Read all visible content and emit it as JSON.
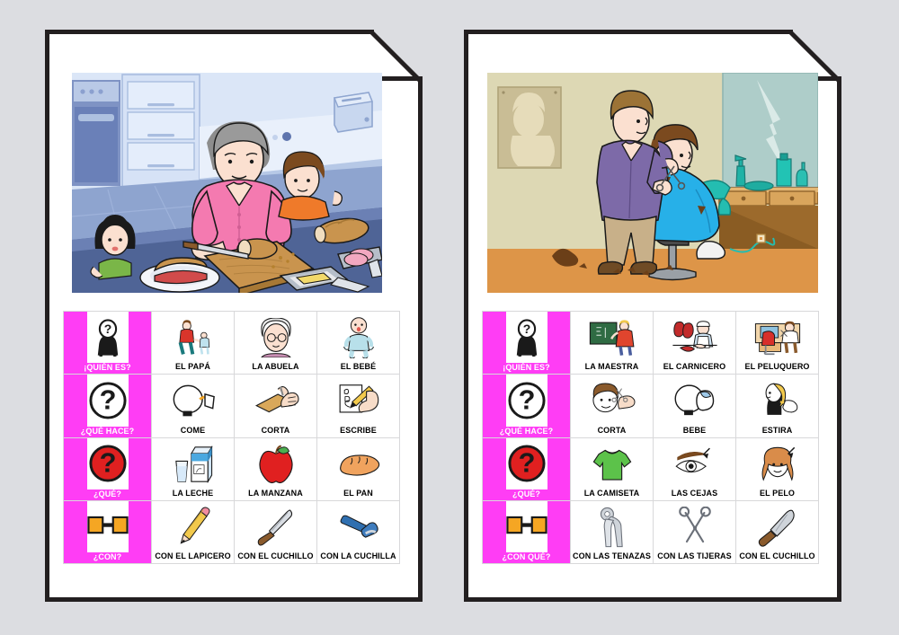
{
  "background_color": "#dcdde1",
  "pages": [
    {
      "id": "page-left",
      "scene": {
        "name": "kitchen-scene",
        "description": "Father cutting bread on a wooden cutting board in a kitchen while two children watch",
        "background_color": "#5b6fa6"
      },
      "table": {
        "rows": [
          {
            "question": {
              "label": "¡QUIÉN ES?",
              "icon": "person-question-icon"
            },
            "cells": [
              {
                "label": "EL PAPÁ",
                "icon": "father-and-child-icon"
              },
              {
                "label": "LA ABUELA",
                "icon": "grandmother-icon"
              },
              {
                "label": "EL BEBÉ",
                "icon": "baby-icon"
              }
            ]
          },
          {
            "question": {
              "label": "¿QUÉ HACE?",
              "icon": "circle-question-icon"
            },
            "cells": [
              {
                "label": "COME",
                "icon": "eating-mouth-icon"
              },
              {
                "label": "CORTA",
                "icon": "hands-cutting-bread-icon"
              },
              {
                "label": "ESCRIBE",
                "icon": "hand-writing-icon"
              }
            ]
          },
          {
            "question": {
              "label": "¿QUÉ?",
              "icon": "red-circle-question-icon"
            },
            "cells": [
              {
                "label": "LA LECHE",
                "icon": "milk-carton-icon"
              },
              {
                "label": "LA MANZANA",
                "icon": "apple-icon"
              },
              {
                "label": "EL PAN",
                "icon": "bread-loaf-icon"
              }
            ]
          },
          {
            "question": {
              "label": "¿CON?",
              "icon": "two-squares-link-icon"
            },
            "cells": [
              {
                "label": "CON EL LAPICERO",
                "icon": "pencil-icon"
              },
              {
                "label": "CON EL CUCHILLO",
                "icon": "knife-icon"
              },
              {
                "label": "CON LA CUCHILLA",
                "icon": "razor-blade-icon"
              }
            ]
          }
        ]
      }
    },
    {
      "id": "page-right",
      "scene": {
        "name": "barber-shop-scene",
        "description": "Barber cutting a boy's hair in a salon with mirror, hair dryer and dressing table",
        "background_color": "#ddd9b5"
      },
      "table": {
        "rows": [
          {
            "question": {
              "label": "¡QUIÉN ES?",
              "icon": "person-question-icon"
            },
            "cells": [
              {
                "label": "LA MAESTRA",
                "icon": "teacher-blackboard-icon"
              },
              {
                "label": "EL CARNICERO",
                "icon": "butcher-icon"
              },
              {
                "label": "EL PELUQUERO",
                "icon": "barber-icon"
              }
            ]
          },
          {
            "question": {
              "label": "¿QUÉ HACE?",
              "icon": "circle-question-icon"
            },
            "cells": [
              {
                "label": "CORTA",
                "icon": "cutting-hair-icon"
              },
              {
                "label": "BEBE",
                "icon": "drinking-mouth-icon"
              },
              {
                "label": "ESTIRA",
                "icon": "pulling-hair-icon"
              }
            ]
          },
          {
            "question": {
              "label": "¿QUÉ?",
              "icon": "red-circle-question-icon"
            },
            "cells": [
              {
                "label": "LA CAMISETA",
                "icon": "green-tshirt-icon"
              },
              {
                "label": "LAS CEJAS",
                "icon": "eyebrow-icon"
              },
              {
                "label": "EL PELO",
                "icon": "hair-head-icon"
              }
            ]
          },
          {
            "question": {
              "label": "¿CON QUÉ?",
              "icon": "two-squares-link-icon"
            },
            "cells": [
              {
                "label": "CON LAS TENAZAS",
                "icon": "pincers-icon"
              },
              {
                "label": "CON LAS TIJERAS",
                "icon": "scissors-icon"
              },
              {
                "label": "CON EL CUCHILLO",
                "icon": "cleaver-knife-icon"
              }
            ]
          }
        ]
      }
    }
  ]
}
